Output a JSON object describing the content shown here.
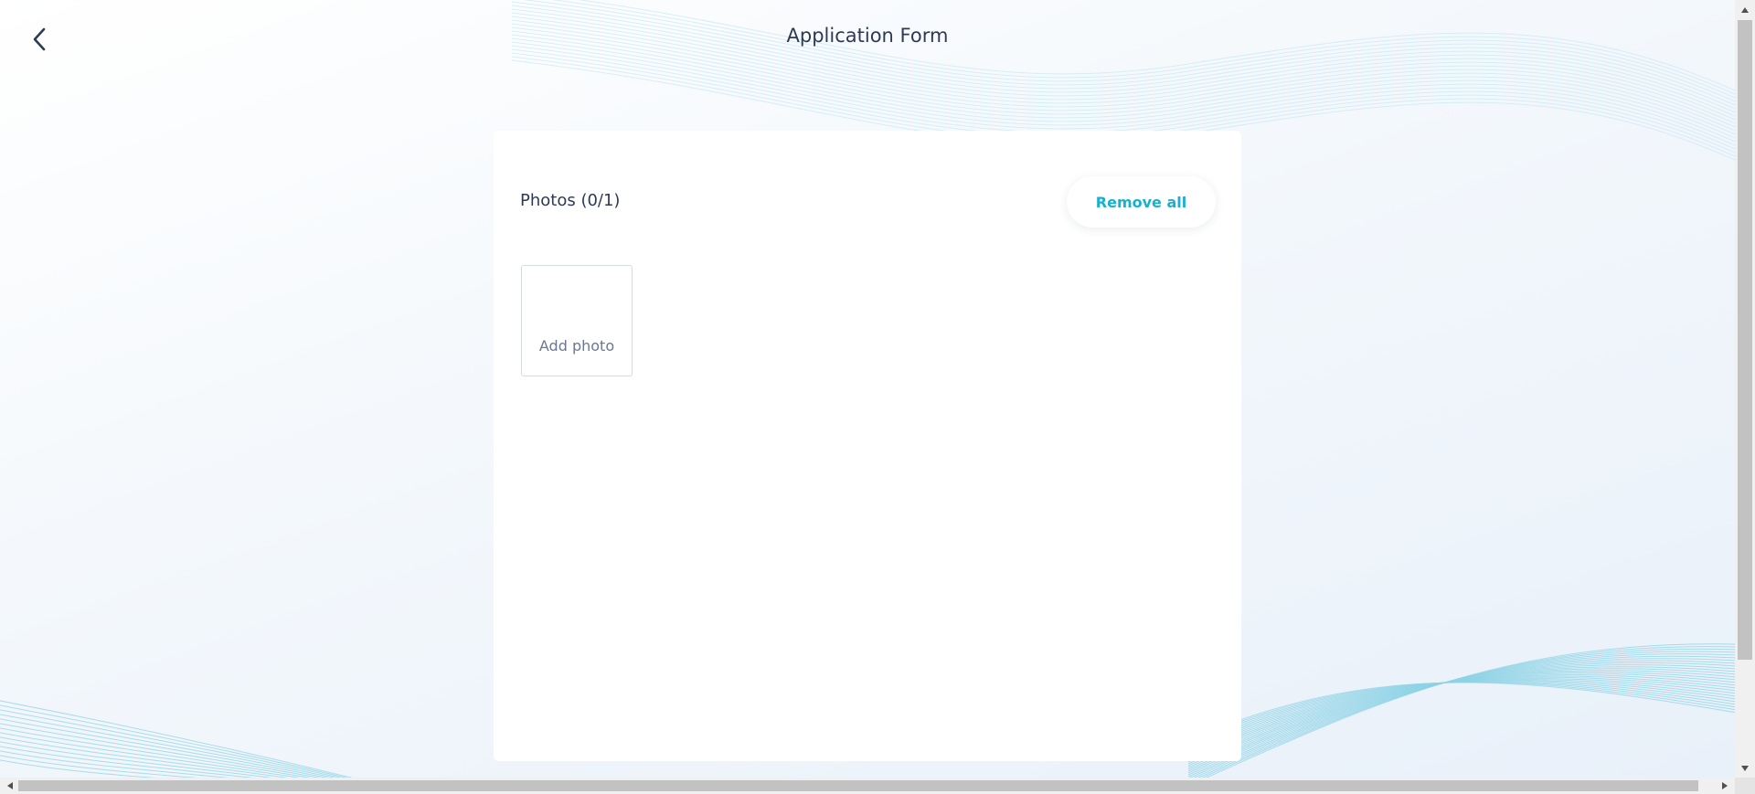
{
  "header": {
    "title": "Application Form",
    "back_icon": "chevron-left-icon"
  },
  "photos": {
    "title": "Photos (0/1)",
    "remove_all_label": "Remove all",
    "add_photo_label": "Add photo"
  },
  "colors": {
    "accent": "#17b0cf",
    "title_text": "#2e3a55",
    "muted_text": "#6a7894",
    "wave_lines": "#7fcfe3"
  }
}
